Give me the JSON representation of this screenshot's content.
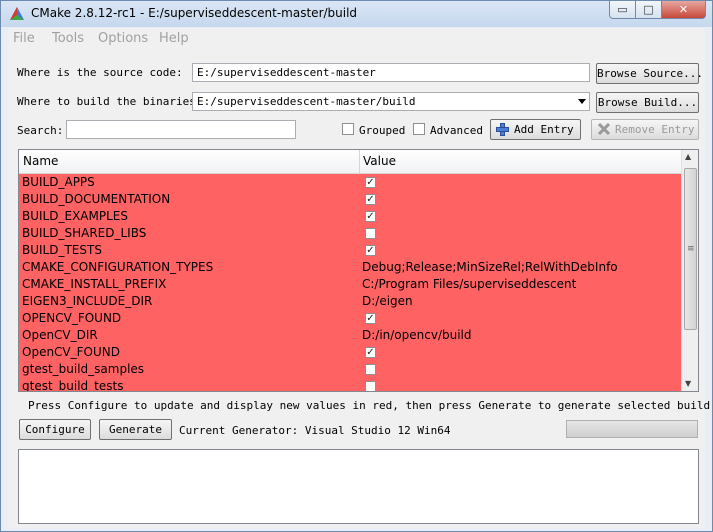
{
  "window": {
    "title": "CMake 2.8.12-rc1 - E:/superviseddescent-master/build",
    "min_glyph": "▭",
    "max_glyph": "□",
    "close_glyph": "✕"
  },
  "menu": [
    "File",
    "Tools",
    "Options",
    "Help"
  ],
  "source": {
    "label": "Where is the source code:",
    "value": "E:/superviseddescent-master",
    "browse_label": "Browse Source..."
  },
  "binaries": {
    "label": "Where to build the binaries:",
    "value": "E:/superviseddescent-master/build",
    "browse_label": "Browse Build..."
  },
  "search": {
    "label": "Search:",
    "value": ""
  },
  "options": {
    "grouped_label": "Grouped",
    "grouped_checked": false,
    "advanced_label": "Advanced",
    "advanced_checked": false,
    "add_entry_label": "Add Entry",
    "remove_entry_label": "Remove Entry"
  },
  "table": {
    "columns": [
      "Name",
      "Value"
    ],
    "row_color": "#ff6262",
    "rows": [
      {
        "name": "BUILD_APPS",
        "type": "bool",
        "value": true
      },
      {
        "name": "BUILD_DOCUMENTATION",
        "type": "bool",
        "value": true
      },
      {
        "name": "BUILD_EXAMPLES",
        "type": "bool",
        "value": true
      },
      {
        "name": "BUILD_SHARED_LIBS",
        "type": "bool",
        "value": false
      },
      {
        "name": "BUILD_TESTS",
        "type": "bool",
        "value": true
      },
      {
        "name": "CMAKE_CONFIGURATION_TYPES",
        "type": "string",
        "value": "Debug;Release;MinSizeRel;RelWithDebInfo"
      },
      {
        "name": "CMAKE_INSTALL_PREFIX",
        "type": "string",
        "value": "C:/Program Files/superviseddescent"
      },
      {
        "name": "EIGEN3_INCLUDE_DIR",
        "type": "string",
        "value": "D:/eigen"
      },
      {
        "name": "OPENCV_FOUND",
        "type": "bool",
        "value": true
      },
      {
        "name": "OpenCV_DIR",
        "type": "string",
        "value": "D:/in/opencv/build"
      },
      {
        "name": "OpenCV_FOUND",
        "type": "bool",
        "value": true
      },
      {
        "name": "gtest_build_samples",
        "type": "bool",
        "value": false
      },
      {
        "name": "gtest_build_tests",
        "type": "bool",
        "value": false
      }
    ]
  },
  "status": {
    "hint": "Press Configure to update and display new values in red, then press Generate to generate selected build files."
  },
  "actions": {
    "configure_label": "Configure",
    "generate_label": "Generate",
    "generator_text": "Current Generator: Visual Studio 12 Win64"
  },
  "progress": {
    "fraction": 0
  },
  "output": {
    "text": ""
  }
}
